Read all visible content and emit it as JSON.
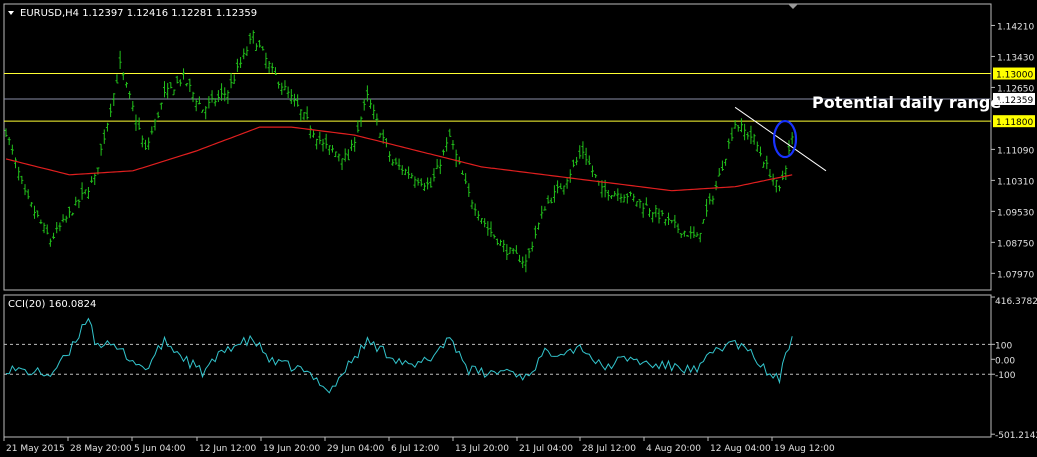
{
  "chart_data": [
    {
      "type": "bar",
      "title": "EURUSD,H4 1.12397 1.12416 1.12281 1.12359",
      "ylim": [
        1.0755,
        1.1475
      ],
      "y_ticks": [
        "1.14210",
        "1.13430",
        "1.12650",
        "1.11090",
        "1.10310",
        "1.09530",
        "1.08750",
        "1.07970"
      ],
      "x_ticks": [
        "21 May 2015",
        "28 May 20:00",
        "5 Jun 04:00",
        "12 Jun 12:00",
        "19 Jun 20:00",
        "29 Jun 04:00",
        "6 Jul 12:00",
        "13 Jul 20:00",
        "21 Jul 04:00",
        "28 Jul 12:00",
        "4 Aug 20:00",
        "12 Aug 04:00",
        "19 Aug 12:00"
      ],
      "grid": false,
      "current_price": {
        "value": 1.12359,
        "label": "1.12359"
      },
      "levels": [
        {
          "value": 1.13,
          "label": "1.13000"
        },
        {
          "value": 1.118,
          "label": "1.11800"
        }
      ],
      "annotation": "Potential daily range",
      "close_keypoints": [
        [
          0,
          1.1155
        ],
        [
          6,
          1.0995
        ],
        [
          14,
          1.088
        ],
        [
          20,
          1.0945
        ],
        [
          28,
          1.1035
        ],
        [
          36,
          1.132
        ],
        [
          44,
          1.1105
        ],
        [
          50,
          1.1245
        ],
        [
          56,
          1.129
        ],
        [
          62,
          1.121
        ],
        [
          70,
          1.1255
        ],
        [
          78,
          1.1395
        ],
        [
          84,
          1.1305
        ],
        [
          92,
          1.1215
        ],
        [
          100,
          1.112
        ],
        [
          108,
          1.1085
        ],
        [
          114,
          1.124
        ],
        [
          122,
          1.1075
        ],
        [
          128,
          1.1045
        ],
        [
          134,
          1.1015
        ],
        [
          140,
          1.114
        ],
        [
          146,
          1.0995
        ],
        [
          152,
          1.091
        ],
        [
          158,
          1.0855
        ],
        [
          164,
          1.0825
        ],
        [
          170,
          1.0965
        ],
        [
          176,
          1.1025
        ],
        [
          182,
          1.1105
        ],
        [
          188,
          1.1005
        ],
        [
          196,
          1.0995
        ],
        [
          204,
          1.0955
        ],
        [
          212,
          1.091
        ],
        [
          218,
          1.0885
        ],
        [
          224,
          1.1015
        ],
        [
          230,
          1.1175
        ],
        [
          236,
          1.1135
        ],
        [
          240,
          1.1065
        ],
        [
          244,
          1.1005
        ],
        [
          248,
          1.1135
        ]
      ],
      "ma_keypoints": [
        [
          0,
          1.1085
        ],
        [
          20,
          1.1045
        ],
        [
          40,
          1.1055
        ],
        [
          60,
          1.1105
        ],
        [
          80,
          1.1165
        ],
        [
          90,
          1.1165
        ],
        [
          110,
          1.1145
        ],
        [
          130,
          1.1105
        ],
        [
          150,
          1.1065
        ],
        [
          170,
          1.1045
        ],
        [
          190,
          1.1025
        ],
        [
          210,
          1.1005
        ],
        [
          230,
          1.1015
        ],
        [
          248,
          1.1045
        ]
      ],
      "bar_count": 249
    },
    {
      "type": "line",
      "title": "CCI(20) 160.0824",
      "ylim": [
        -520,
        430
      ],
      "y_ticks": [
        {
          "value": 416.3782,
          "label": "416.3782"
        },
        {
          "value": 100,
          "label": "100"
        },
        {
          "value": 0,
          "label": "0.00"
        },
        {
          "value": -100,
          "label": "-100"
        },
        {
          "value": -501.2142,
          "label": "-501.2142"
        }
      ],
      "levels": [
        100,
        -100
      ],
      "cci_keypoints": [
        [
          0,
          -60
        ],
        [
          6,
          -80
        ],
        [
          14,
          -100
        ],
        [
          20,
          40
        ],
        [
          26,
          300
        ],
        [
          28,
          120
        ],
        [
          36,
          60
        ],
        [
          44,
          -70
        ],
        [
          50,
          120
        ],
        [
          56,
          10
        ],
        [
          62,
          -90
        ],
        [
          70,
          80
        ],
        [
          78,
          130
        ],
        [
          84,
          -20
        ],
        [
          92,
          -60
        ],
        [
          100,
          -160
        ],
        [
          102,
          -220
        ],
        [
          108,
          -40
        ],
        [
          114,
          120
        ],
        [
          122,
          20
        ],
        [
          128,
          -60
        ],
        [
          134,
          10
        ],
        [
          140,
          150
        ],
        [
          146,
          -70
        ],
        [
          152,
          -100
        ],
        [
          158,
          -70
        ],
        [
          164,
          -120
        ],
        [
          170,
          40
        ],
        [
          176,
          60
        ],
        [
          182,
          80
        ],
        [
          188,
          -60
        ],
        [
          196,
          10
        ],
        [
          204,
          -40
        ],
        [
          212,
          -50
        ],
        [
          218,
          -80
        ],
        [
          224,
          70
        ],
        [
          230,
          110
        ],
        [
          236,
          20
        ],
        [
          240,
          -90
        ],
        [
          244,
          -130
        ],
        [
          248,
          160
        ]
      ]
    }
  ],
  "colors": {
    "background": "#000000",
    "bars": "#22c11b",
    "moving_average": "#e01f1f",
    "level_line": "#ffff33",
    "level_label_bg": "#ffff00",
    "current_price_line": "#8a8ea8",
    "current_price_label_bg": "#ffffff",
    "trendline": "#ffffff",
    "highlight_ellipse": "#1833ff",
    "cci_line": "#33c4cc",
    "axis_text": "#e0e0e0",
    "frame": "#bcbcbc"
  },
  "icons": {
    "symbol_menu": "triangle-down-icon",
    "scroll_marker": "triangle-down-icon"
  }
}
